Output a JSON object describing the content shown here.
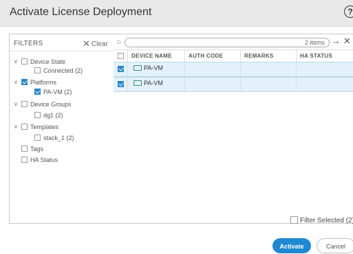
{
  "dialog": {
    "title": "Activate License Deployment",
    "help_glyph": "?"
  },
  "filters": {
    "heading": "FILTERS",
    "clear_label": "Clear",
    "tree": [
      {
        "label": "Device State",
        "child": "Connected (2)",
        "checked": false
      },
      {
        "label": "Platforms",
        "child": "PA-VM (2)",
        "checked": true
      },
      {
        "label": "Device Groups",
        "child": "dg1 (2)",
        "checked": false
      },
      {
        "label": "Templates",
        "child": "stack_1 (2)",
        "checked": false
      },
      {
        "label": "Tags",
        "checked": false
      },
      {
        "label": "HA Status",
        "checked": false
      }
    ]
  },
  "grid": {
    "search_placeholder": "",
    "items_count": "2 items",
    "columns": [
      "DEVICE NAME",
      "AUTH CODE",
      "REMARKS",
      "HA STATUS"
    ],
    "rows": [
      {
        "device_name": "PA-VM",
        "auth_code": "",
        "remarks": "",
        "ha_status": "",
        "checked": true
      },
      {
        "device_name": "PA-VM",
        "auth_code": "",
        "remarks": "",
        "ha_status": "",
        "checked": true
      }
    ]
  },
  "footer": {
    "filter_selected_label": "Filter Selected (2)",
    "activate_label": "Activate",
    "cancel_label": "Cancel"
  },
  "colors": {
    "accent": "#1f88d2",
    "row_selected": "#e3f1fa",
    "titlebar": "#e9e9e9"
  }
}
